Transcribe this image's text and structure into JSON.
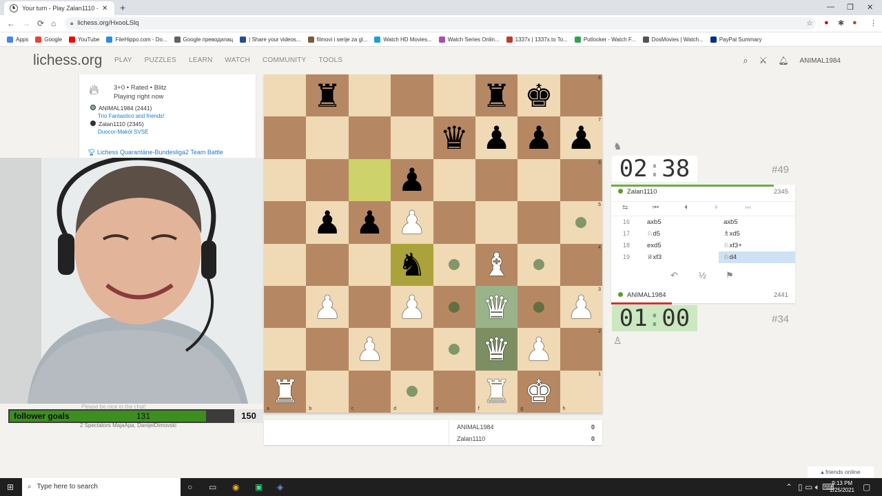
{
  "browser": {
    "tab_title": "Your turn - Play Zalan1110 -",
    "url": "lichess.org/HxooLSlq",
    "bookmarks": [
      {
        "label": "Apps",
        "color": "#4285f4"
      },
      {
        "label": "Google",
        "color": "#ea4335"
      },
      {
        "label": "YouTube",
        "color": "#ff0000"
      },
      {
        "label": "FileHippo.com - Do...",
        "color": "#2b8be6"
      },
      {
        "label": "Google преводилац",
        "color": "#5f6368"
      },
      {
        "label": "| Share your videos...",
        "color": "#1f4e9a"
      },
      {
        "label": "filmovi i serije za gl...",
        "color": "#7d5a3c"
      },
      {
        "label": "Watch HD Movies...",
        "color": "#18a0e0"
      },
      {
        "label": "Watch Series Onlin...",
        "color": "#b04ab0"
      },
      {
        "label": "1337x | 1337x.to To...",
        "color": "#c0392b"
      },
      {
        "label": "Putlocker - Watch F...",
        "color": "#2ea44f"
      },
      {
        "label": "DosMovies | Watch...",
        "color": "#555555"
      },
      {
        "label": "PayPal Summary",
        "color": "#003087"
      }
    ]
  },
  "header": {
    "logo": "lichess.org",
    "nav": [
      "PLAY",
      "PUZZLES",
      "LEARN",
      "WATCH",
      "COMMUNITY",
      "TOOLS"
    ],
    "username": "ANIMAL1984"
  },
  "game_info": {
    "type": "3+0 • Rated • Blitz",
    "status": "Playing right now",
    "white": "ANIMAL1984 (2441)",
    "white_team": "Trio Fantastico and friends!",
    "black": "Zalan1110 (2345)",
    "black_team": "Duocor-Makól SVSE",
    "arena": "Lichess Quarantäne-Bundesliga2 Team Battle"
  },
  "stream": {
    "goal_label": "follower goals",
    "goal_current": "131",
    "goal_target": "150",
    "goal_fraction": 0.873,
    "chat_placeholder": "Please be nice in the chat!",
    "spectators": "2 Spectators MajaApa, DanijelDimovski"
  },
  "board": {
    "files": [
      "a",
      "b",
      "c",
      "d",
      "e",
      "f",
      "g",
      "h"
    ],
    "ranks": [
      "8",
      "7",
      "6",
      "5",
      "4",
      "3",
      "2",
      "1"
    ],
    "rows": [
      [
        "",
        "bR",
        "",
        "",
        "",
        "bR",
        "bK",
        ""
      ],
      [
        "",
        "",
        "",
        "",
        "bQ",
        "bP",
        "bP",
        "bP"
      ],
      [
        "",
        "",
        "",
        "bP",
        "",
        "",
        "",
        ""
      ],
      [
        "",
        "bP",
        "bP",
        "wP",
        "",
        "",
        "",
        ""
      ],
      [
        "",
        "",
        "",
        "bN",
        "",
        "wB",
        "",
        ""
      ],
      [
        "",
        "wP",
        "",
        "wP",
        "",
        "wQ",
        "",
        "wP"
      ],
      [
        "",
        "",
        "wP",
        "",
        "",
        "wQ",
        "wP",
        ""
      ],
      [
        "wR",
        "",
        "",
        "",
        "",
        "wR",
        "wK",
        ""
      ]
    ],
    "highlights": [
      "c6",
      "d4"
    ],
    "selected": [
      "f3",
      "f2"
    ],
    "move_dots": [
      "h5",
      "e4",
      "g4",
      "e3",
      "g3",
      "e2",
      "d1"
    ]
  },
  "scores": [
    {
      "name": "ANIMAL1984",
      "score": "0"
    },
    {
      "name": "Zalan1110",
      "score": "0"
    }
  ],
  "clocks": {
    "top": {
      "min": "02",
      "sec": "38",
      "rank": "#49"
    },
    "bottom": {
      "min": "01",
      "sec": "00",
      "rank": "#34"
    }
  },
  "players": {
    "top": {
      "name": "Zalan1110",
      "rating": "2345"
    },
    "bottom": {
      "name": "ANIMAL1984",
      "rating": "2441"
    }
  },
  "moves": [
    {
      "n": "16",
      "w": "axb5",
      "b": "axb5"
    },
    {
      "n": "17",
      "w": "♘d5",
      "b": "♗xd5"
    },
    {
      "n": "18",
      "w": "exd5",
      "b": "♘xf3+"
    },
    {
      "n": "19",
      "w": "♕xf3",
      "b": "♘d4"
    }
  ],
  "actions": {
    "draw": "½"
  },
  "friends": "friends online",
  "taskbar": {
    "search_placeholder": "Type here to search",
    "time": "9:13 PM",
    "date": "2/25/2021"
  }
}
